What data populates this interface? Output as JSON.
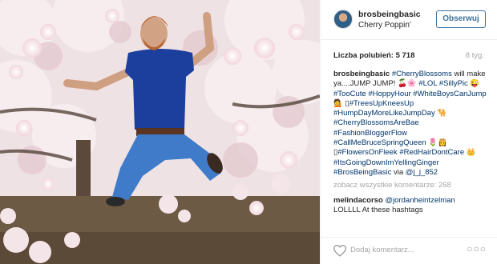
{
  "post": {
    "username": "brosbeingbasic",
    "location": "Cherry Poppin'",
    "follow_label": "Obserwuj",
    "likes_label": "Liczba polubień: 5 718",
    "age": "8 tyg."
  },
  "caption": {
    "user": "brosbeingbasic",
    "t1": " ",
    "h1": "#CherryBlossoms",
    "t2": " will make ya....JUMP JUMP! 🍒🌸 ",
    "h2": "#LOL",
    "t3": " ",
    "h3": "#SillyPic",
    "t4": " 😜 ",
    "h4": "#TooCute",
    "t5": " ",
    "h5": "#HoppyHour",
    "t6": " ",
    "h6": "#WhiteBoysCanJump",
    "t7": " 💁 ",
    "t7b": "▯",
    "h7": "#TreesUpKneesUp",
    "t8": " ",
    "h8": "#HumpDayMoreLikeJumpDay",
    "t9": " 🐪 ",
    "h9": "#CherryBlossomsAreBae",
    "t10": " ",
    "h10": "#FashionBloggerFlow",
    "t11": " ",
    "h11": "#CallMeBruceSpringQueen",
    "t12": " 🌷👸 ",
    "t12b": "▯",
    "h12": "#FlowersOnFleek",
    "t13": " ",
    "h13": "#RedHairDontCare",
    "t14": " 👑 ",
    "h14": "#ItsGoingDownImYellingGinger",
    "t15": " ",
    "h15": "#BrosBeingBasic",
    "t16": " via ",
    "h16": "@j_j_852"
  },
  "view_all": "zobacz wszystkie komentarze: 268",
  "comment": {
    "user": "melindacorso",
    "mention": "@jordanheintzelman",
    "text": "LOLLLL At these hashtags"
  },
  "footer": {
    "add_comment_placeholder": "Dodaj komentarz...",
    "more_glyph": "○○○"
  },
  "colors": {
    "link": "#003569",
    "follow_blue": "#3f729b",
    "muted": "#a5a7aa"
  },
  "icons": [
    "heart-icon",
    "more-options-icon"
  ]
}
